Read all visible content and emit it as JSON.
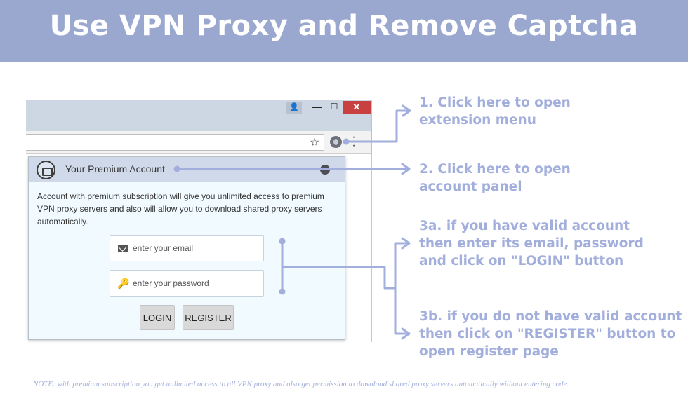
{
  "banner": {
    "title": "Use VPN Proxy and Remove Captcha"
  },
  "browser": {
    "window_buttons": {
      "minimize": "—",
      "maximize": "☐",
      "close": "✕",
      "user": "👤"
    },
    "toolbar": {
      "star_icon": "star-icon",
      "extension_icon": "extension-icon",
      "menu_icon": "menu-icon",
      "address_value": ""
    }
  },
  "panel": {
    "title": "Your Premium Account",
    "description": "Account with premium subscription will give you unlimited access to premium VPN proxy servers and also will allow you to download shared proxy servers automatically.",
    "email": {
      "placeholder": "enter your email",
      "icon": "envelope-icon"
    },
    "password": {
      "placeholder": "enter your password",
      "icon": "key-icon"
    },
    "login_label": "LOGIN",
    "register_label": "REGISTER"
  },
  "annotations": {
    "step1": "1. Click here to open\nextension menu",
    "step2": "2. Click here to open\naccount panel",
    "step3a": "3a. if you have valid account\nthen enter its email, password\nand click on \"LOGIN\" button",
    "step3b": "3b. if you do not have valid account\nthen click on \"REGISTER\" button to\nopen register page"
  },
  "footnote": "NOTE: with premium subscription you get unlimited access to all VPN proxy and also get permission to download shared proxy servers automatically without entering code.",
  "colors": {
    "banner": "#9aa8cf",
    "annotation": "#a2aedb",
    "panel_bg": "#f1fbff",
    "close_button": "#c94040"
  }
}
